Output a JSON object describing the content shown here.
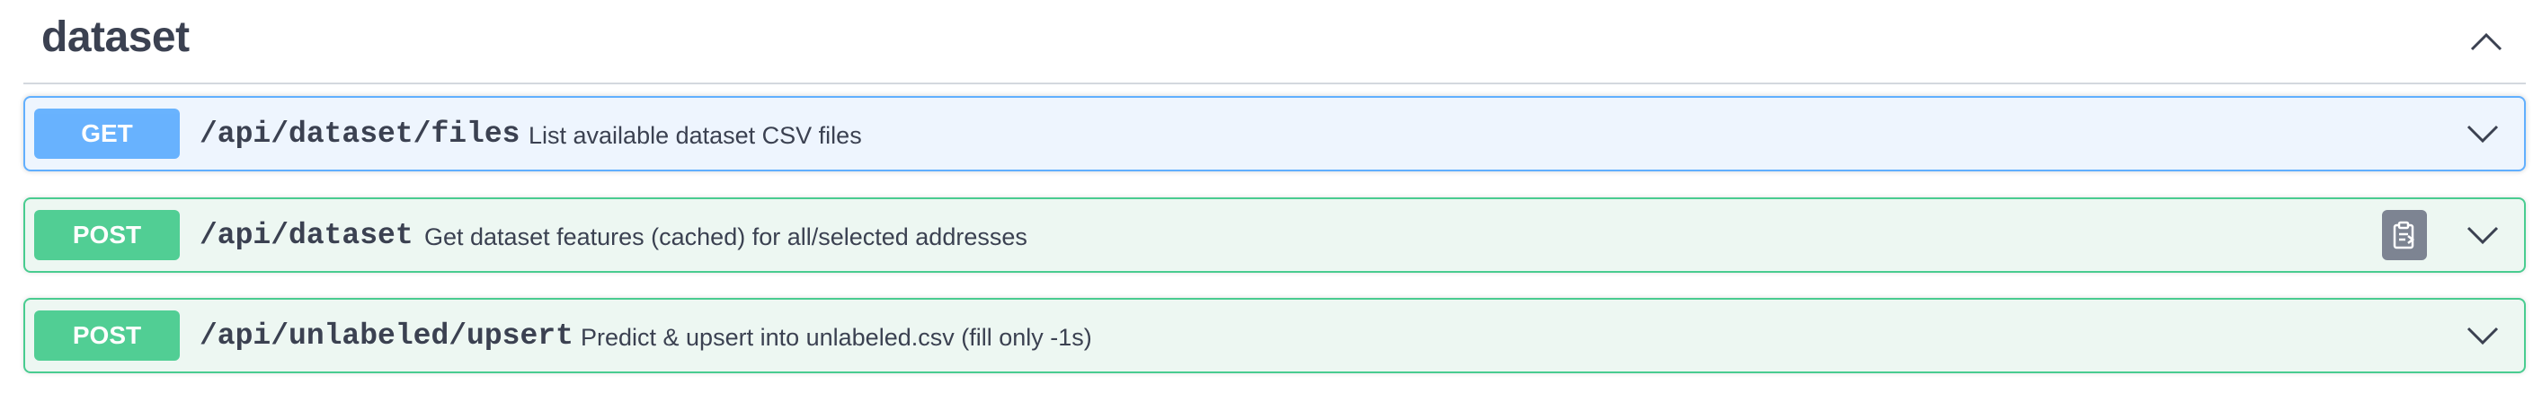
{
  "section": {
    "title": "dataset",
    "toggle_icon": "chevron-up-icon"
  },
  "operations": [
    {
      "method": "GET",
      "path": "/api/dataset/files",
      "summary": "List available dataset CSV files",
      "expand_icon": "chevron-down-icon"
    },
    {
      "method": "POST",
      "path": "/api/dataset",
      "summary": "Get dataset features (cached) for all/selected addresses",
      "copy_icon": "clipboard-copy-icon",
      "expand_icon": "chevron-down-icon"
    },
    {
      "method": "POST",
      "path": "/api/unlabeled/upsert",
      "summary": "Predict & upsert into unlabeled.csv (fill only -1s)",
      "expand_icon": "chevron-down-icon"
    }
  ],
  "colors": {
    "get": "#61affe",
    "post": "#49cc90",
    "get_bg": "#eef5fe",
    "post_bg": "#edf7f2",
    "text": "#3b4151",
    "copy_button": "#7d8492"
  }
}
